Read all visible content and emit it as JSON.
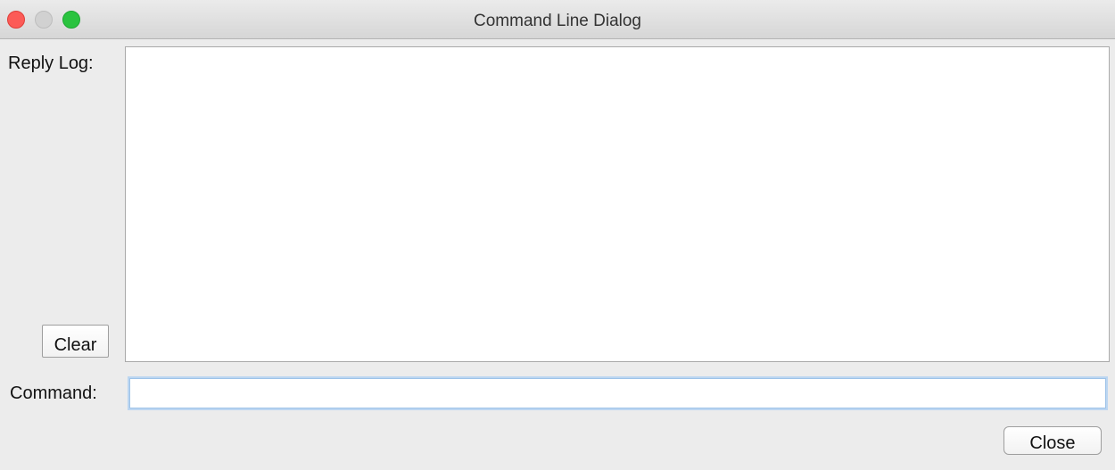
{
  "window": {
    "title": "Command Line Dialog",
    "controls": [
      "close",
      "minimize",
      "zoom"
    ]
  },
  "reply_log": {
    "label": "Reply Log:",
    "content": "",
    "clear_label": "Clear"
  },
  "command": {
    "label": "Command:",
    "value": "",
    "placeholder": ""
  },
  "footer": {
    "close_label": "Close"
  },
  "colors": {
    "close_dot": "#fc5b57",
    "minimize_dot": "#d1d1d1",
    "zoom_dot": "#2ac33f",
    "focus_ring": "#9ec3e8"
  }
}
